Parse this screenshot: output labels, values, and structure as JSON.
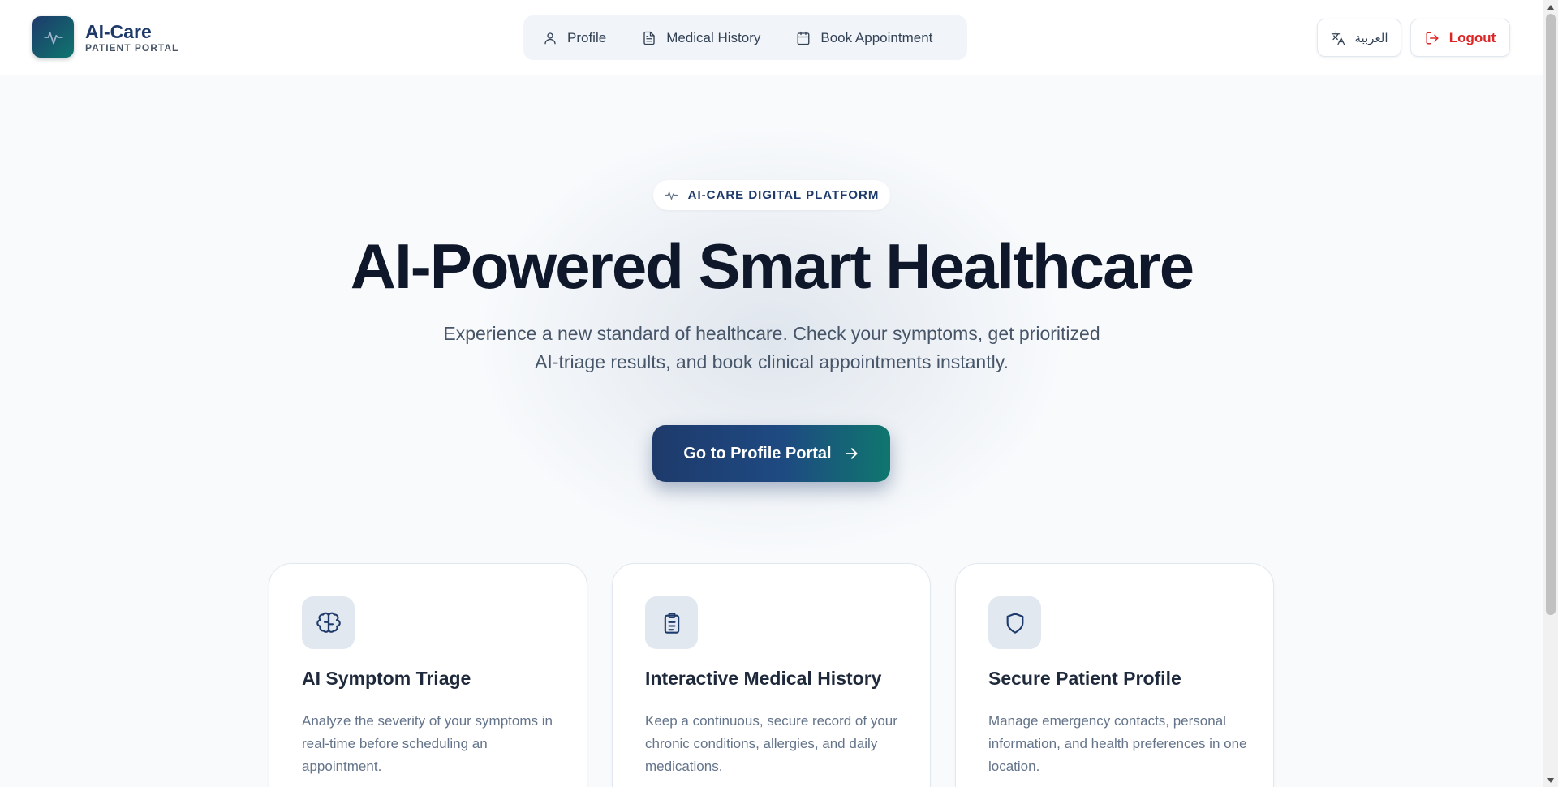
{
  "brand": {
    "name": "AI-Care",
    "subtitle": "PATIENT PORTAL",
    "icon": "heartbeat-icon"
  },
  "nav": {
    "items": [
      {
        "label": "Profile",
        "icon": "user-icon"
      },
      {
        "label": "Medical History",
        "icon": "document-icon"
      },
      {
        "label": "Book Appointment",
        "icon": "calendar-icon"
      }
    ]
  },
  "header_actions": {
    "language_label": "العربية",
    "language_icon": "translate-icon",
    "logout_label": "Logout",
    "logout_icon": "logout-icon"
  },
  "hero": {
    "badge": "AI-CARE DIGITAL PLATFORM",
    "title": "AI-Powered Smart Healthcare",
    "description": "Experience a new standard of healthcare. Check your symptoms, get prioritized AI-triage results, and book clinical appointments instantly.",
    "cta_label": "Go to Profile Portal"
  },
  "features": [
    {
      "title": "AI Symptom Triage",
      "text": "Analyze the severity of your symptoms in real-time before scheduling an appointment.",
      "icon": "brain-icon"
    },
    {
      "title": "Interactive Medical History",
      "text": "Keep a continuous, secure record of your chronic conditions, allergies, and daily medications.",
      "icon": "clipboard-icon"
    },
    {
      "title": "Secure Patient Profile",
      "text": "Manage emergency contacts, personal information, and health preferences in one location.",
      "icon": "shield-icon"
    }
  ],
  "colors": {
    "brand": "#1e3a6b",
    "accent": "#0f766e",
    "danger": "#dc2626"
  }
}
